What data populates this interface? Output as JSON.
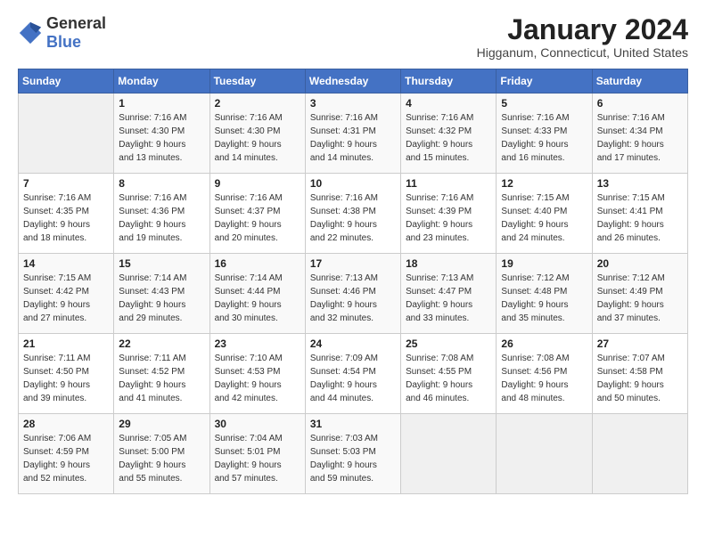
{
  "logo": {
    "general": "General",
    "blue": "Blue"
  },
  "title": "January 2024",
  "location": "Higganum, Connecticut, United States",
  "days_of_week": [
    "Sunday",
    "Monday",
    "Tuesday",
    "Wednesday",
    "Thursday",
    "Friday",
    "Saturday"
  ],
  "weeks": [
    [
      {
        "day": "",
        "info": ""
      },
      {
        "day": "1",
        "info": "Sunrise: 7:16 AM\nSunset: 4:30 PM\nDaylight: 9 hours\nand 13 minutes."
      },
      {
        "day": "2",
        "info": "Sunrise: 7:16 AM\nSunset: 4:30 PM\nDaylight: 9 hours\nand 14 minutes."
      },
      {
        "day": "3",
        "info": "Sunrise: 7:16 AM\nSunset: 4:31 PM\nDaylight: 9 hours\nand 14 minutes."
      },
      {
        "day": "4",
        "info": "Sunrise: 7:16 AM\nSunset: 4:32 PM\nDaylight: 9 hours\nand 15 minutes."
      },
      {
        "day": "5",
        "info": "Sunrise: 7:16 AM\nSunset: 4:33 PM\nDaylight: 9 hours\nand 16 minutes."
      },
      {
        "day": "6",
        "info": "Sunrise: 7:16 AM\nSunset: 4:34 PM\nDaylight: 9 hours\nand 17 minutes."
      }
    ],
    [
      {
        "day": "7",
        "info": "Sunrise: 7:16 AM\nSunset: 4:35 PM\nDaylight: 9 hours\nand 18 minutes."
      },
      {
        "day": "8",
        "info": "Sunrise: 7:16 AM\nSunset: 4:36 PM\nDaylight: 9 hours\nand 19 minutes."
      },
      {
        "day": "9",
        "info": "Sunrise: 7:16 AM\nSunset: 4:37 PM\nDaylight: 9 hours\nand 20 minutes."
      },
      {
        "day": "10",
        "info": "Sunrise: 7:16 AM\nSunset: 4:38 PM\nDaylight: 9 hours\nand 22 minutes."
      },
      {
        "day": "11",
        "info": "Sunrise: 7:16 AM\nSunset: 4:39 PM\nDaylight: 9 hours\nand 23 minutes."
      },
      {
        "day": "12",
        "info": "Sunrise: 7:15 AM\nSunset: 4:40 PM\nDaylight: 9 hours\nand 24 minutes."
      },
      {
        "day": "13",
        "info": "Sunrise: 7:15 AM\nSunset: 4:41 PM\nDaylight: 9 hours\nand 26 minutes."
      }
    ],
    [
      {
        "day": "14",
        "info": "Sunrise: 7:15 AM\nSunset: 4:42 PM\nDaylight: 9 hours\nand 27 minutes."
      },
      {
        "day": "15",
        "info": "Sunrise: 7:14 AM\nSunset: 4:43 PM\nDaylight: 9 hours\nand 29 minutes."
      },
      {
        "day": "16",
        "info": "Sunrise: 7:14 AM\nSunset: 4:44 PM\nDaylight: 9 hours\nand 30 minutes."
      },
      {
        "day": "17",
        "info": "Sunrise: 7:13 AM\nSunset: 4:46 PM\nDaylight: 9 hours\nand 32 minutes."
      },
      {
        "day": "18",
        "info": "Sunrise: 7:13 AM\nSunset: 4:47 PM\nDaylight: 9 hours\nand 33 minutes."
      },
      {
        "day": "19",
        "info": "Sunrise: 7:12 AM\nSunset: 4:48 PM\nDaylight: 9 hours\nand 35 minutes."
      },
      {
        "day": "20",
        "info": "Sunrise: 7:12 AM\nSunset: 4:49 PM\nDaylight: 9 hours\nand 37 minutes."
      }
    ],
    [
      {
        "day": "21",
        "info": "Sunrise: 7:11 AM\nSunset: 4:50 PM\nDaylight: 9 hours\nand 39 minutes."
      },
      {
        "day": "22",
        "info": "Sunrise: 7:11 AM\nSunset: 4:52 PM\nDaylight: 9 hours\nand 41 minutes."
      },
      {
        "day": "23",
        "info": "Sunrise: 7:10 AM\nSunset: 4:53 PM\nDaylight: 9 hours\nand 42 minutes."
      },
      {
        "day": "24",
        "info": "Sunrise: 7:09 AM\nSunset: 4:54 PM\nDaylight: 9 hours\nand 44 minutes."
      },
      {
        "day": "25",
        "info": "Sunrise: 7:08 AM\nSunset: 4:55 PM\nDaylight: 9 hours\nand 46 minutes."
      },
      {
        "day": "26",
        "info": "Sunrise: 7:08 AM\nSunset: 4:56 PM\nDaylight: 9 hours\nand 48 minutes."
      },
      {
        "day": "27",
        "info": "Sunrise: 7:07 AM\nSunset: 4:58 PM\nDaylight: 9 hours\nand 50 minutes."
      }
    ],
    [
      {
        "day": "28",
        "info": "Sunrise: 7:06 AM\nSunset: 4:59 PM\nDaylight: 9 hours\nand 52 minutes."
      },
      {
        "day": "29",
        "info": "Sunrise: 7:05 AM\nSunset: 5:00 PM\nDaylight: 9 hours\nand 55 minutes."
      },
      {
        "day": "30",
        "info": "Sunrise: 7:04 AM\nSunset: 5:01 PM\nDaylight: 9 hours\nand 57 minutes."
      },
      {
        "day": "31",
        "info": "Sunrise: 7:03 AM\nSunset: 5:03 PM\nDaylight: 9 hours\nand 59 minutes."
      },
      {
        "day": "",
        "info": ""
      },
      {
        "day": "",
        "info": ""
      },
      {
        "day": "",
        "info": ""
      }
    ]
  ]
}
